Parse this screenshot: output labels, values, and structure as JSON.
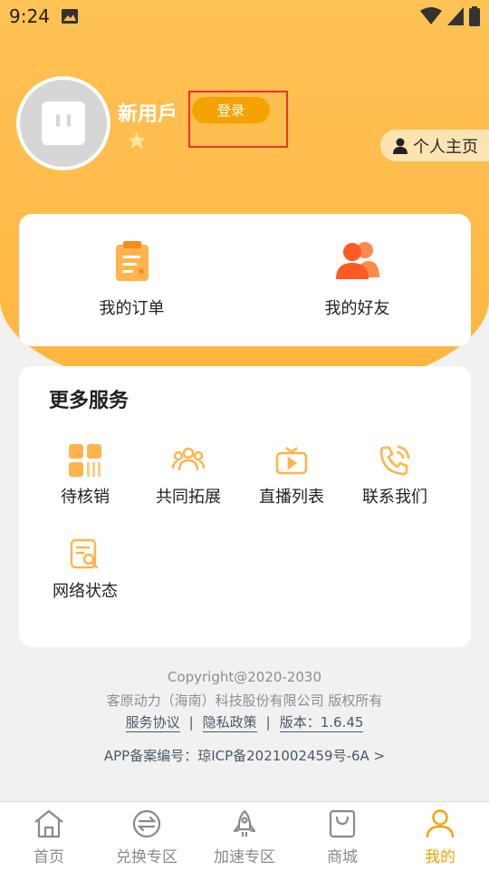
{
  "status_bar": {
    "time": "9:24"
  },
  "profile": {
    "username": "新用戶",
    "login_label": "登录",
    "home_label": "个人主页"
  },
  "quick_actions": [
    {
      "label": "我的订单",
      "icon": "clipboard-icon"
    },
    {
      "label": "我的好友",
      "icon": "friends-icon"
    }
  ],
  "services": {
    "title": "更多服务",
    "items": [
      {
        "label": "待核销",
        "icon": "grid-barcode-icon"
      },
      {
        "label": "共同拓展",
        "icon": "group-icon"
      },
      {
        "label": "直播列表",
        "icon": "tv-play-icon"
      },
      {
        "label": "联系我们",
        "icon": "phone-icon"
      },
      {
        "label": "网络状态",
        "icon": "doc-search-icon"
      }
    ]
  },
  "footer": {
    "copyright": "Copyright@2020-2030",
    "company": "客原动力（海南）科技股份有限公司 版权所有",
    "service_agreement": "服务协议",
    "privacy_policy": "隐私政策",
    "version": "版本：1.6.45",
    "icp": "APP备案编号：琼ICP备2021002459号-6A >"
  },
  "tabbar": [
    {
      "label": "首页",
      "icon": "home-icon"
    },
    {
      "label": "兑换专区",
      "icon": "exchange-icon"
    },
    {
      "label": "加速专区",
      "icon": "rocket-icon"
    },
    {
      "label": "商城",
      "icon": "shopping-bag-icon"
    },
    {
      "label": "我的",
      "icon": "user-icon",
      "active": true
    }
  ],
  "colors": {
    "header": "#ffbc4a",
    "accent": "#f5a300",
    "icon_orange": "#ff6a2c"
  }
}
